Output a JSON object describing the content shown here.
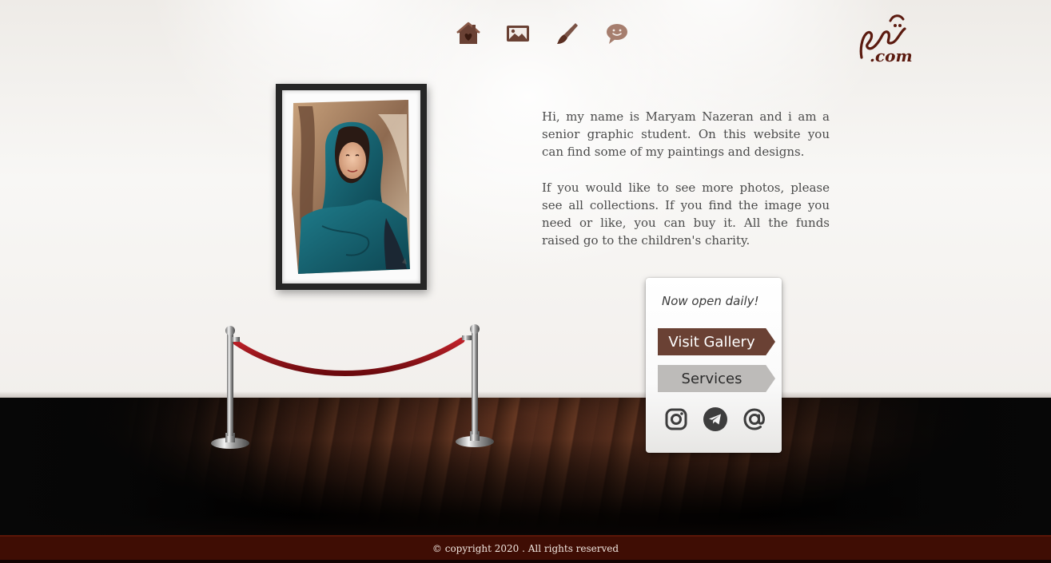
{
  "nav": {
    "items": [
      {
        "id": "home",
        "icon": "home-icon"
      },
      {
        "id": "gallery",
        "icon": "image-icon"
      },
      {
        "id": "paint",
        "icon": "brush-icon"
      },
      {
        "id": "contact",
        "icon": "chat-icon"
      }
    ]
  },
  "logo": {
    "script_glyph": "مریم",
    "domain": ".com"
  },
  "intro": {
    "paragraph_1": "Hi, my name is Maryam Nazeran and i am a senior graphic student. On this website you can find some of my paintings and designs.",
    "paragraph_2": "If you would like to see more photos, please see all collections. If you find the image you need or like, you can buy it. All the funds raised go to the children's charity."
  },
  "panel": {
    "tagline": "Now open daily!",
    "visit_label": "Visit Gallery",
    "services_label": "Services",
    "socials": [
      {
        "id": "instagram",
        "icon": "instagram-icon"
      },
      {
        "id": "telegram",
        "icon": "telegram-icon"
      },
      {
        "id": "email",
        "icon": "at-sign-icon"
      }
    ]
  },
  "footer": {
    "copyright": "© copyright 2020 . All rights reserved"
  },
  "colors": {
    "brand_brown": "#6a4134",
    "footer_bg": "#3f0d04",
    "rope_red": "#9b0f14",
    "text_gray": "#4b4b4b"
  }
}
